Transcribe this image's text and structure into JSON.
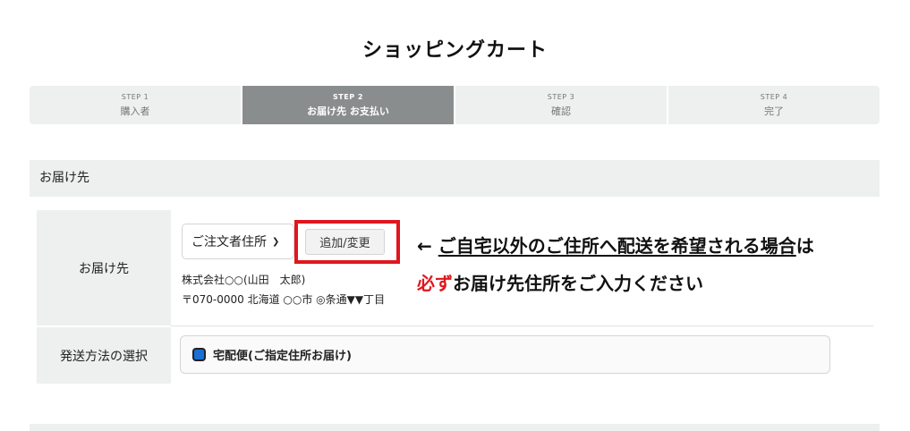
{
  "page": {
    "title": "ショッピングカート"
  },
  "steps": [
    {
      "num": "STEP 1",
      "label": "購入者",
      "active": false
    },
    {
      "num": "STEP 2",
      "label": "お届け先 お支払い",
      "active": true
    },
    {
      "num": "STEP 3",
      "label": "確認",
      "active": false
    },
    {
      "num": "STEP 4",
      "label": "完了",
      "active": false
    }
  ],
  "section": {
    "heading": "お届け先"
  },
  "delivery": {
    "label": "お届け先",
    "select_value": "ご注文者住所",
    "add_button": "追加/変更",
    "address_line1": "株式会社○○(山田　太郎)",
    "address_line2": "〒070-0000 北海道 ○○市 ◎条通▼▼丁目"
  },
  "annotation": {
    "arrow": "←",
    "line1": "ご自宅以外のご住所へ配送を希望される場合",
    "line1_tail": "は",
    "line2_emphasis": "必ず",
    "line2_rest": "お届け先住所をご入力ください"
  },
  "shipping": {
    "label": "発送方法の選択",
    "option": "宅配便(ご指定住所お届け)"
  },
  "colors": {
    "accent_red": "#e0161e",
    "radio_blue": "#1a6fd6",
    "active_step": "#8a8d8e"
  }
}
